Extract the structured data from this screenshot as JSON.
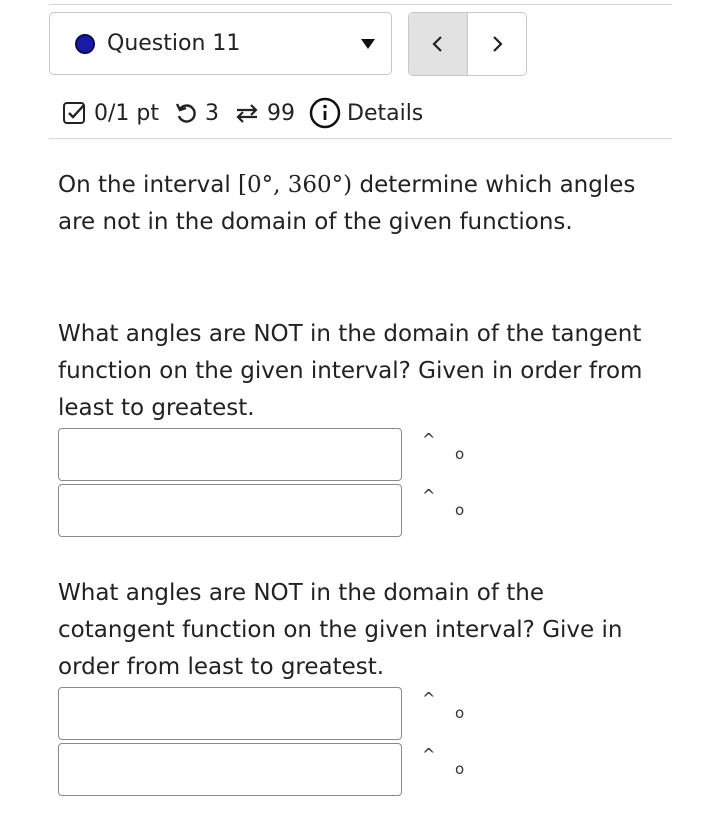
{
  "question": {
    "label": "Question 11"
  },
  "nav": {
    "prev": "<",
    "next": ">"
  },
  "meta": {
    "score": "0/1 pt",
    "retries": "3",
    "attempts": "99",
    "details": "Details"
  },
  "intro": {
    "before": "On the interval ",
    "math": "[0°, 360°)",
    "after": " determine which angles are not in the domain of the given functions."
  },
  "part1": {
    "prompt": "What angles are NOT in the domain of the tangent function on the given interval? Given in order from least to greatest.",
    "inputs": [
      {
        "value": "",
        "hat": "^",
        "degree": "o"
      },
      {
        "value": "",
        "hat": "^",
        "degree": "o"
      }
    ]
  },
  "part2": {
    "prompt": "What angles are NOT in the domain of the cotangent function on the given interval? Give in order from least to greatest.",
    "inputs": [
      {
        "value": "",
        "hat": "^",
        "degree": "o"
      },
      {
        "value": "",
        "hat": "^",
        "degree": "o"
      }
    ]
  }
}
